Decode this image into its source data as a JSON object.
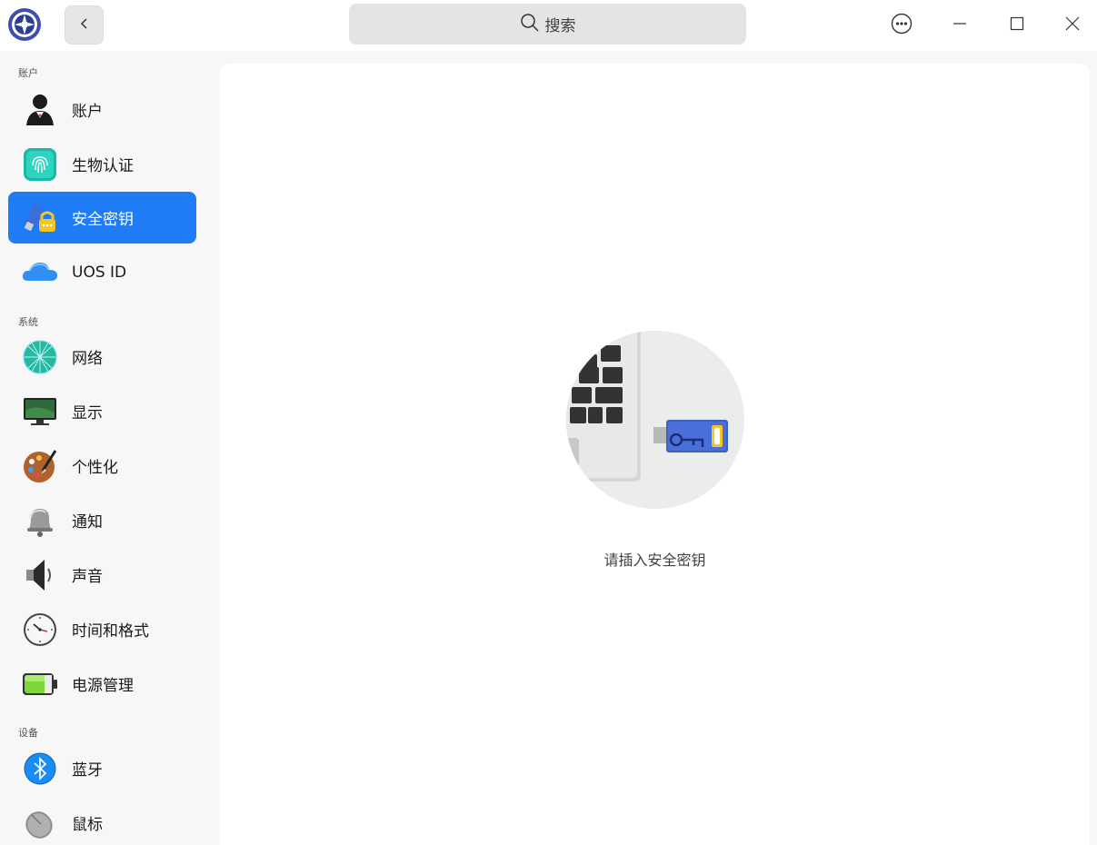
{
  "search": {
    "label": "搜索"
  },
  "sidebar": {
    "sections": [
      {
        "label": "账户"
      },
      {
        "label": "系统"
      },
      {
        "label": "设备"
      }
    ],
    "items": [
      {
        "label": "账户",
        "icon": "account-icon"
      },
      {
        "label": "生物认证",
        "icon": "fingerprint-icon"
      },
      {
        "label": "安全密钥",
        "icon": "security-key-icon",
        "active": true
      },
      {
        "label": "UOS ID",
        "icon": "cloud-icon"
      },
      {
        "label": "网络",
        "icon": "network-icon"
      },
      {
        "label": "显示",
        "icon": "display-icon"
      },
      {
        "label": "个性化",
        "icon": "palette-icon"
      },
      {
        "label": "通知",
        "icon": "bell-icon"
      },
      {
        "label": "声音",
        "icon": "speaker-icon"
      },
      {
        "label": "时间和格式",
        "icon": "clock-icon"
      },
      {
        "label": "电源管理",
        "icon": "battery-icon"
      },
      {
        "label": "蓝牙",
        "icon": "bluetooth-icon"
      },
      {
        "label": "鼠标",
        "icon": "mouse-icon"
      }
    ]
  },
  "main": {
    "prompt": "请插入安全密钥"
  },
  "colors": {
    "accent": "#1f7cf7",
    "background": "#f7f7f7",
    "panel": "#ffffff"
  }
}
